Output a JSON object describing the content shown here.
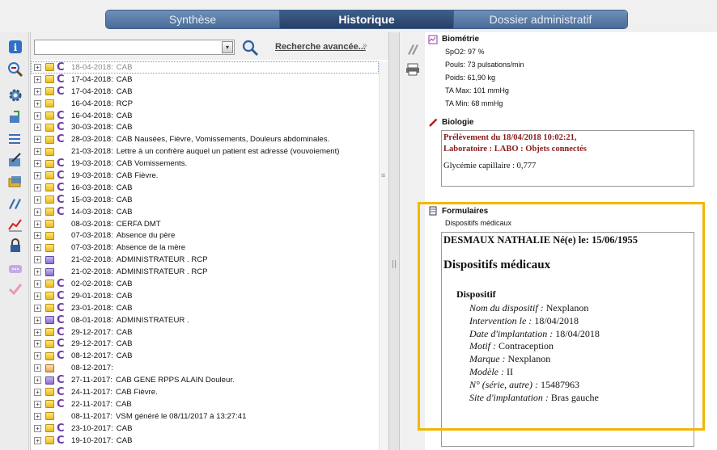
{
  "tabs": [
    {
      "label": "Synthèse",
      "active": false
    },
    {
      "label": "Historique",
      "active": true
    },
    {
      "label": "Dossier administratif",
      "active": false
    }
  ],
  "search": {
    "value": "",
    "advanced_label": "Recherche avancée...",
    "advanced_chevron": "»"
  },
  "history": [
    {
      "c": true,
      "folder": "yellow",
      "date": "18-04-2018:",
      "text": "CAB",
      "selected": true
    },
    {
      "c": true,
      "folder": "yellow",
      "date": "17-04-2018:",
      "text": "CAB"
    },
    {
      "c": true,
      "folder": "yellow",
      "date": "17-04-2018:",
      "text": "CAB"
    },
    {
      "c": false,
      "folder": "yellow",
      "date": "16-04-2018:",
      "text": "RCP"
    },
    {
      "c": true,
      "folder": "yellow",
      "date": "16-04-2018:",
      "text": "CAB"
    },
    {
      "c": true,
      "folder": "yellow",
      "date": "30-03-2018:",
      "text": "CAB"
    },
    {
      "c": true,
      "folder": "yellow",
      "date": "28-03-2018:",
      "text": "CAB  Nausées, Fièvre, Vomissements, Douleurs abdominales."
    },
    {
      "c": false,
      "folder": "yellow",
      "date": "21-03-2018:",
      "text": "Lettre à un confrère auquel un patient est adressé (vouvoiement)"
    },
    {
      "c": true,
      "folder": "yellow",
      "date": "19-03-2018:",
      "text": "CAB  Vomissements."
    },
    {
      "c": true,
      "folder": "yellow",
      "date": "19-03-2018:",
      "text": "CAB  Fièvre."
    },
    {
      "c": true,
      "folder": "yellow",
      "date": "16-03-2018:",
      "text": "CAB"
    },
    {
      "c": true,
      "folder": "yellow",
      "date": "15-03-2018:",
      "text": "CAB"
    },
    {
      "c": true,
      "folder": "yellow",
      "date": "14-03-2018:",
      "text": "CAB"
    },
    {
      "c": false,
      "folder": "yellow",
      "date": "08-03-2018:",
      "text": "CERFA DMT"
    },
    {
      "c": false,
      "folder": "yellow",
      "date": "07-03-2018:",
      "text": "Absence du père"
    },
    {
      "c": false,
      "folder": "yellow",
      "date": "07-03-2018:",
      "text": "Absence de la mère"
    },
    {
      "c": false,
      "folder": "purple",
      "date": "21-02-2018:",
      "text": "ADMINISTRATEUR . RCP"
    },
    {
      "c": false,
      "folder": "purple",
      "date": "21-02-2018:",
      "text": "ADMINISTRATEUR . RCP"
    },
    {
      "c": true,
      "folder": "yellow",
      "date": "02-02-2018:",
      "text": "CAB"
    },
    {
      "c": true,
      "folder": "yellow",
      "date": "29-01-2018:",
      "text": "CAB"
    },
    {
      "c": true,
      "folder": "yellow",
      "date": "23-01-2018:",
      "text": "CAB"
    },
    {
      "c": true,
      "folder": "purple",
      "date": "08-01-2018:",
      "text": "ADMINISTRATEUR ."
    },
    {
      "c": true,
      "folder": "yellow",
      "date": "29-12-2017:",
      "text": "CAB"
    },
    {
      "c": true,
      "folder": "yellow",
      "date": "29-12-2017:",
      "text": "CAB"
    },
    {
      "c": true,
      "folder": "yellow",
      "date": "08-12-2017:",
      "text": "CAB"
    },
    {
      "c": false,
      "folder": "mail",
      "date": "08-12-2017:",
      "text": ""
    },
    {
      "c": true,
      "folder": "purple",
      "date": "27-11-2017:",
      "text": "CAB GENE RPPS ALAIN Douleur."
    },
    {
      "c": true,
      "folder": "yellow",
      "date": "24-11-2017:",
      "text": "CAB  Fièvre."
    },
    {
      "c": true,
      "folder": "yellow",
      "date": "22-11-2017:",
      "text": "CAB"
    },
    {
      "c": false,
      "folder": "yellow",
      "date": "08-11-2017:",
      "text": "VSM généré le 08/11/2017 à 13:27:41"
    },
    {
      "c": true,
      "folder": "yellow",
      "date": "23-10-2017:",
      "text": "CAB"
    },
    {
      "c": true,
      "folder": "yellow",
      "date": "19-10-2017:",
      "text": "CAB"
    }
  ],
  "biometrie": {
    "title": "Biométrie",
    "lines": [
      "SpO2: 97 %",
      "Pouls: 73 pulsations/min",
      "Poids: 61,90 kg",
      "TA Max: 101 mmHg",
      "TA Min: 68 mmHg"
    ]
  },
  "biologie": {
    "title": "Biologie",
    "line1": "Prélèvement du 18/04/2018 10:02:21,",
    "line2": "Laboratoire : LABO : Objets connectés",
    "result": "Glycémie capillaire : 0,777"
  },
  "formulaires": {
    "title": "Formulaires",
    "subtitle": "Dispositifs médicaux",
    "patient": "DESMAUX NATHALIE Né(e) le: 15/06/1955",
    "heading": "Dispositifs médicaux",
    "section": "Dispositif",
    "fields": [
      {
        "label": "Nom du dispositif :",
        "value": "Nexplanon"
      },
      {
        "label": "Intervention le    :",
        "value": "18/04/2018"
      },
      {
        "label": "Date d'implantation :",
        "value": "18/04/2018"
      },
      {
        "label": "Motif :",
        "value": "Contraception"
      },
      {
        "label": "Marque :",
        "value": "Nexplanon"
      },
      {
        "label": "Modèle :",
        "value": "II"
      },
      {
        "label": "N° (série, autre) :",
        "value": "15487963"
      },
      {
        "label": "Site d'implantation :",
        "value": "Bras gauche"
      }
    ]
  },
  "icons": {
    "toolbar": [
      "info-icon",
      "zoom-out-icon",
      "gear-icon",
      "transfer-icon",
      "sort-icon",
      "edit-icon",
      "card-icon",
      "write-icon",
      "chart-icon",
      "lock-icon",
      "message-icon",
      "check-icon"
    ],
    "right": [
      "notes-icon",
      "printer-icon"
    ]
  }
}
